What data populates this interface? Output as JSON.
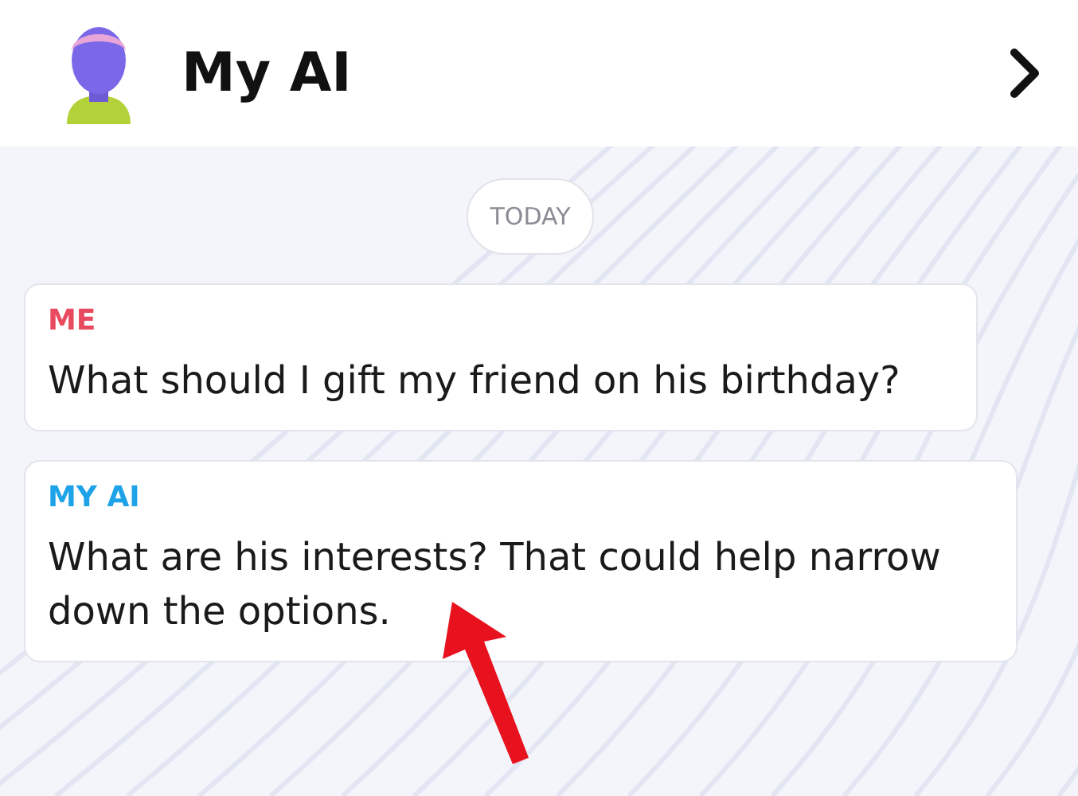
{
  "header": {
    "title": "My AI"
  },
  "date_divider": "TODAY",
  "messages": [
    {
      "sender": "ME",
      "color": "#e84a5f",
      "text": "What should I gift my friend on his birthday?"
    },
    {
      "sender": "MY AI",
      "color": "#1fa3e8",
      "text": "What are his interests? That could help narrow down the options."
    }
  ]
}
